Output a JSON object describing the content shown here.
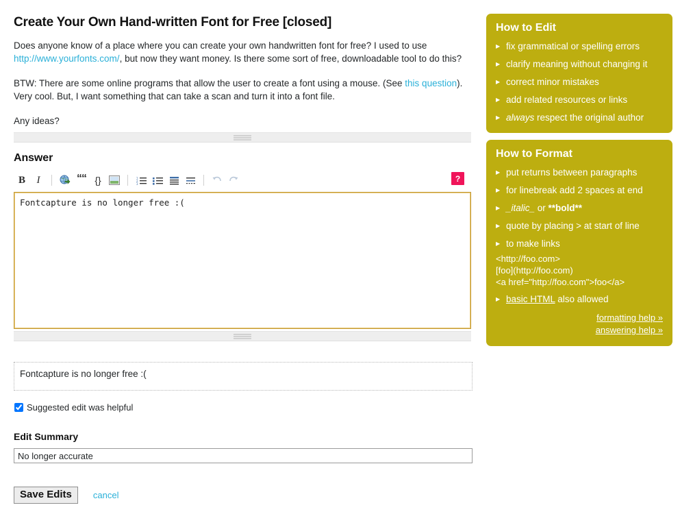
{
  "question": {
    "title": "Create Your Own Hand-written Font for Free [closed]",
    "paragraph1_pre": "Does anyone know of a place where you can create your own handwritten font for free? I used to use ",
    "paragraph1_link": "http://www.yourfonts.com/",
    "paragraph1_post": ", but now they want money. Is there some sort of free, downloadable tool to do this?",
    "paragraph2_pre": "BTW: There are some online programs that allow the user to create a font using a mouse. (See ",
    "paragraph2_link": "this question",
    "paragraph2_post": "). Very cool. But, I want something that can take a scan and turn it into a font file.",
    "paragraph3": "Any ideas?"
  },
  "answer": {
    "heading": "Answer",
    "textarea_value": "Fontcapture is no longer free :(",
    "preview_text": "Fontcapture is no longer free :(",
    "toolbar": {
      "bold_label": "B",
      "italic_label": "I",
      "quote_label": "“",
      "code_label": "{}",
      "help_label": "?"
    }
  },
  "helpful": {
    "label": "Suggested edit was helpful",
    "checked": true
  },
  "edit_summary": {
    "label": "Edit Summary",
    "value": "No longer accurate",
    "placeholder": ""
  },
  "actions": {
    "save_label": "Save Edits",
    "cancel_label": "cancel"
  },
  "sidebar": {
    "how_to_edit": {
      "title": "How to Edit",
      "items": [
        "fix grammatical or spelling errors",
        "clarify meaning without changing it",
        "correct minor mistakes",
        "add related resources or links"
      ],
      "last_item_em": "always",
      "last_item_rest": " respect the original author"
    },
    "how_to_format": {
      "title": "How to Format",
      "items": [
        "put returns between paragraphs",
        "for linebreak add 2 spaces at end"
      ],
      "italic_bold_item": {
        "italic_part": "_italic_",
        "or_text": " or ",
        "bold_part": "**bold**"
      },
      "items2": [
        "quote by placing > at start of line",
        "to make links"
      ],
      "code_lines": [
        "<http://foo.com>",
        "[foo](http://foo.com)",
        "<a href=\"http://foo.com\">foo</a>"
      ],
      "html_item_link": "basic HTML",
      "html_item_rest": " also allowed",
      "links": [
        "formatting help »",
        "answering help »"
      ]
    }
  },
  "colors": {
    "sidebar_bg": "#bdae10",
    "link": "#2ab0d8",
    "help_button_bg": "#f0145a",
    "textarea_border": "#c49a33"
  }
}
